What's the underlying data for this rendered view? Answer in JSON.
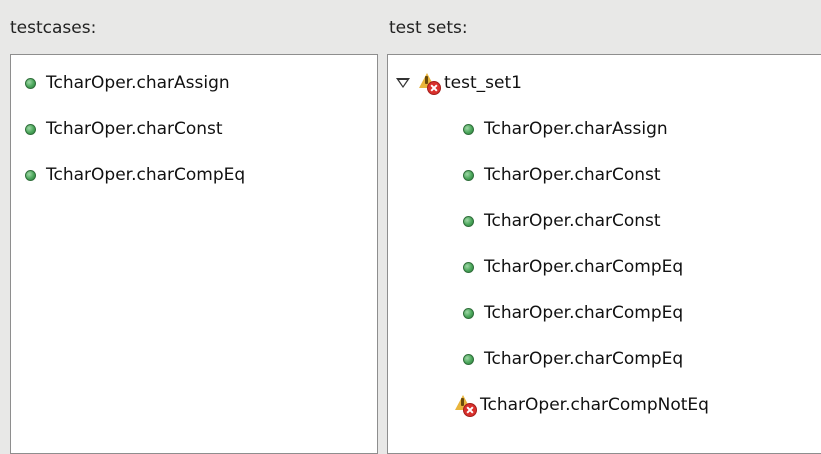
{
  "labels": {
    "testcases": "testcases:",
    "testsets": "test sets:"
  },
  "testcases": [
    {
      "label": "TcharOper.charAssign",
      "status_icon": "green-dot-icon"
    },
    {
      "label": "TcharOper.charConst",
      "status_icon": "green-dot-icon"
    },
    {
      "label": "TcharOper.charCompEq",
      "status_icon": "green-dot-icon"
    }
  ],
  "testsets": {
    "root": {
      "label": "test_set1",
      "expanded": true,
      "status_icon": "warning-error-icon"
    },
    "children": [
      {
        "label": "TcharOper.charAssign",
        "status_icon": "green-dot-icon"
      },
      {
        "label": "TcharOper.charConst",
        "status_icon": "green-dot-icon"
      },
      {
        "label": "TcharOper.charConst",
        "status_icon": "green-dot-icon"
      },
      {
        "label": "TcharOper.charCompEq",
        "status_icon": "green-dot-icon"
      },
      {
        "label": "TcharOper.charCompEq",
        "status_icon": "green-dot-icon"
      },
      {
        "label": "TcharOper.charCompEq",
        "status_icon": "green-dot-icon"
      },
      {
        "label": "TcharOper.charCompNotEq",
        "status_icon": "warning-error-icon"
      }
    ]
  },
  "colors": {
    "background": "#e8e8e7",
    "panel": "#ffffff",
    "ok_dot": "#4aa65a",
    "error_badge": "#d9302c",
    "warning": "#e9b53c"
  }
}
